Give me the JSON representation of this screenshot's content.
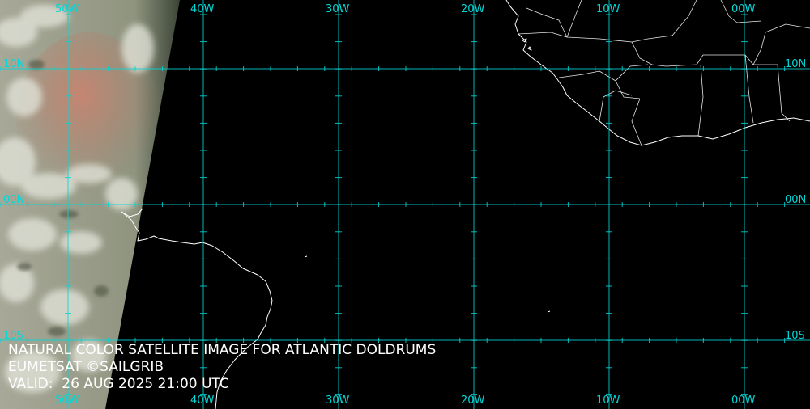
{
  "caption": {
    "title": "NATURAL COLOR SATELLITE IMAGE FOR ATLANTIC DOLDRUMS",
    "credit": "EUMETSAT ©SAILGRIB",
    "valid": "VALID:  26 AUG 2025 21:00 UTC"
  },
  "longitude_labels": [
    "50W",
    "40W",
    "30W",
    "20W",
    "10W",
    "00W"
  ],
  "latitude_labels": [
    "10N",
    "00N",
    "10S"
  ],
  "colors": {
    "grid": "#00d8d8",
    "coastline": "#ffffff",
    "background": "#000000",
    "caption_text": "#ffffff"
  }
}
